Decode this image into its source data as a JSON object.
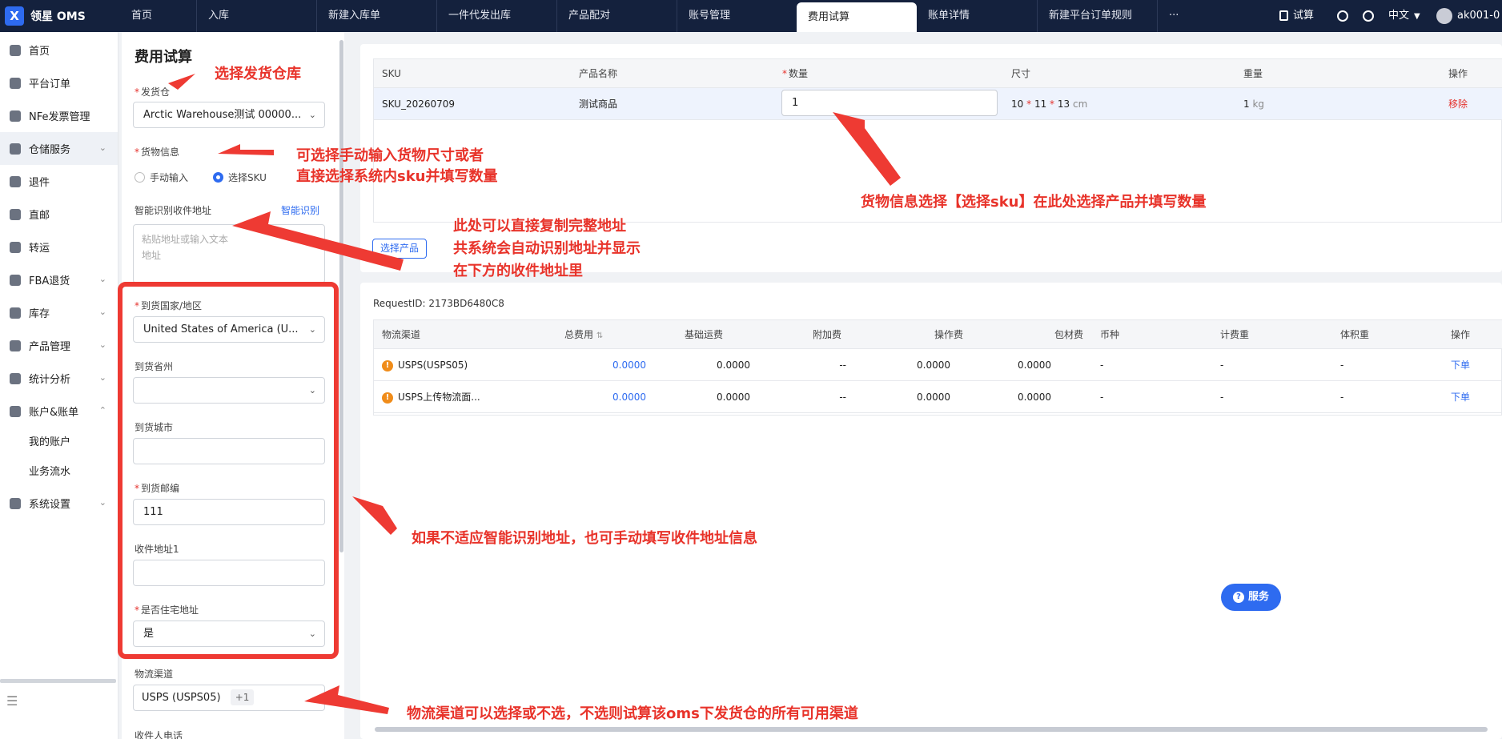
{
  "app": {
    "logo_mark": "X",
    "title": "领星 OMS"
  },
  "nav_tabs": [
    "首页",
    "入库",
    "新建入库单",
    "一件代发出库",
    "产品配对",
    "账号管理",
    "费用试算",
    "账单详情",
    "新建平台订单规则"
  ],
  "nav_more": "···",
  "topright": {
    "calc": "试算",
    "lang": "中文",
    "user": "ak001-0"
  },
  "sidebar": [
    {
      "label": "首页"
    },
    {
      "label": "平台订单"
    },
    {
      "label": "NFe发票管理"
    },
    {
      "label": "仓储服务",
      "arrow": "⌄"
    },
    {
      "label": "退件"
    },
    {
      "label": "直邮"
    },
    {
      "label": "转运"
    },
    {
      "label": "FBA退货",
      "arrow": "⌄"
    },
    {
      "label": "库存",
      "arrow": "⌄"
    },
    {
      "label": "产品管理",
      "arrow": "⌄"
    },
    {
      "label": "统计分析",
      "arrow": "⌄"
    },
    {
      "label": "账户&账单",
      "arrow": "⌃"
    }
  ],
  "sidebar_sub": [
    "我的账户",
    "业务流水"
  ],
  "sidebar_last": {
    "label": "系统设置",
    "arrow": "⌄"
  },
  "form": {
    "title": "费用试算",
    "warehouse_label": "发货仓",
    "warehouse_value": "Arctic Warehouse测试 00000...",
    "goods_label": "货物信息",
    "radio_manual": "手动输入",
    "radio_sku": "选择SKU",
    "smart_label": "智能识别收件地址",
    "smart_link": "智能识别",
    "smart_placeholder_1": "粘贴地址或输入文本",
    "smart_placeholder_2": "地址",
    "country_label": "到货国家/地区",
    "country_value": "United States of America (U...",
    "state_label": "到货省州",
    "city_label": "到货城市",
    "zip_label": "到货邮编",
    "zip_value": "111",
    "addr1_label": "收件地址1",
    "residential_label": "是否住宅地址",
    "residential_value": "是",
    "channel_label": "物流渠道",
    "channel_value": "USPS (USPS05)",
    "channel_more": "+1",
    "phone_label": "收件人电话"
  },
  "sku_table": {
    "headers": [
      "SKU",
      "产品名称",
      "数量",
      "尺寸",
      "重量",
      "操作"
    ],
    "row": {
      "sku": "SKU_20260709",
      "name": "测试商品",
      "qty": "1",
      "dim_l": "10",
      "dim_w": "11",
      "dim_h": "13",
      "dim_unit": "cm",
      "weight": "1",
      "weight_unit": "kg",
      "action": "移除"
    }
  },
  "select_product_button": "选择产品",
  "request_id": "RequestID: 2173BD6480C8",
  "fee_table": {
    "headers": [
      "物流渠道",
      "总费用",
      "基础运费",
      "附加费",
      "操作费",
      "包材费",
      "币种",
      "计费重",
      "体积重",
      "操作"
    ],
    "rows": [
      {
        "channel": "USPS(USPS05)",
        "total": "0.0000",
        "base": "0.0000",
        "extra": "--",
        "op": "0.0000",
        "pack": "0.0000",
        "cur": "-",
        "cw": "-",
        "vw": "-",
        "action": "下单"
      },
      {
        "channel": "USPS上传物流面...",
        "total": "0.0000",
        "base": "0.0000",
        "extra": "--",
        "op": "0.0000",
        "pack": "0.0000",
        "cur": "-",
        "cw": "-",
        "vw": "-",
        "action": "下单"
      }
    ]
  },
  "service_button": "服务",
  "annotations": {
    "a1": "选择发货仓库",
    "a2_1": "可选择手动输入货物尺寸或者",
    "a2_2": "直接选择系统内sku并填写数量",
    "a3_1": "此处可以直接复制完整地址",
    "a3_2": "共系统会自动识别地址并显示",
    "a3_3": "在下方的收件地址里",
    "a4": "货物信息选择【选择sku】在此处选择产品并填写数量",
    "a5": "如果不适应智能识别地址，也可手动填写收件地址信息",
    "a6": "物流渠道可以选择或不选，不选则试算该oms下发货仓的所有可用渠道"
  },
  "colors": {
    "topbar": "#14213d",
    "accent": "#2e6bf0",
    "annotation": "#e8332a"
  }
}
